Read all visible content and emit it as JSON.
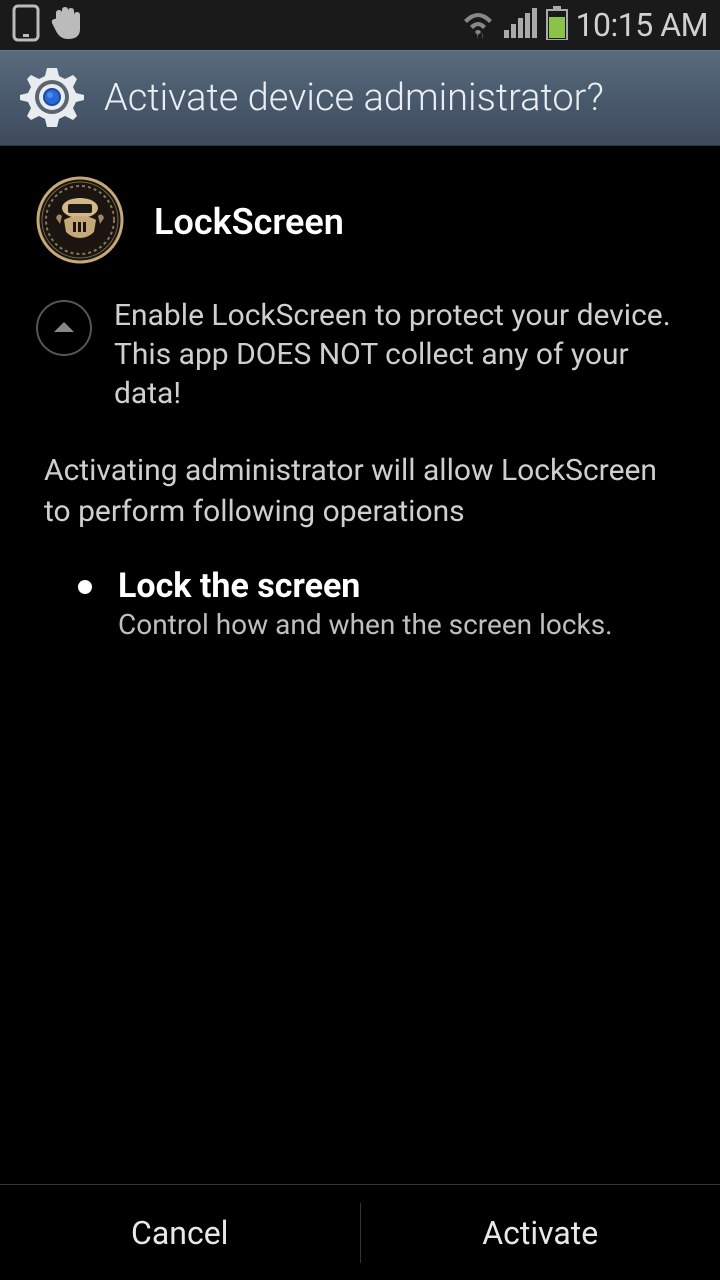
{
  "status_bar": {
    "time": "10:15 AM"
  },
  "header": {
    "title": "Activate device administrator?"
  },
  "app": {
    "name": "LockScreen",
    "description": "Enable LockScreen to protect your device. This app DOES NOT collect any of your data!"
  },
  "activate_info": "Activating administrator will allow LockScreen to perform following operations",
  "permissions": [
    {
      "title": "Lock the screen",
      "description": "Control how and when the screen locks."
    }
  ],
  "buttons": {
    "cancel": "Cancel",
    "activate": "Activate"
  }
}
